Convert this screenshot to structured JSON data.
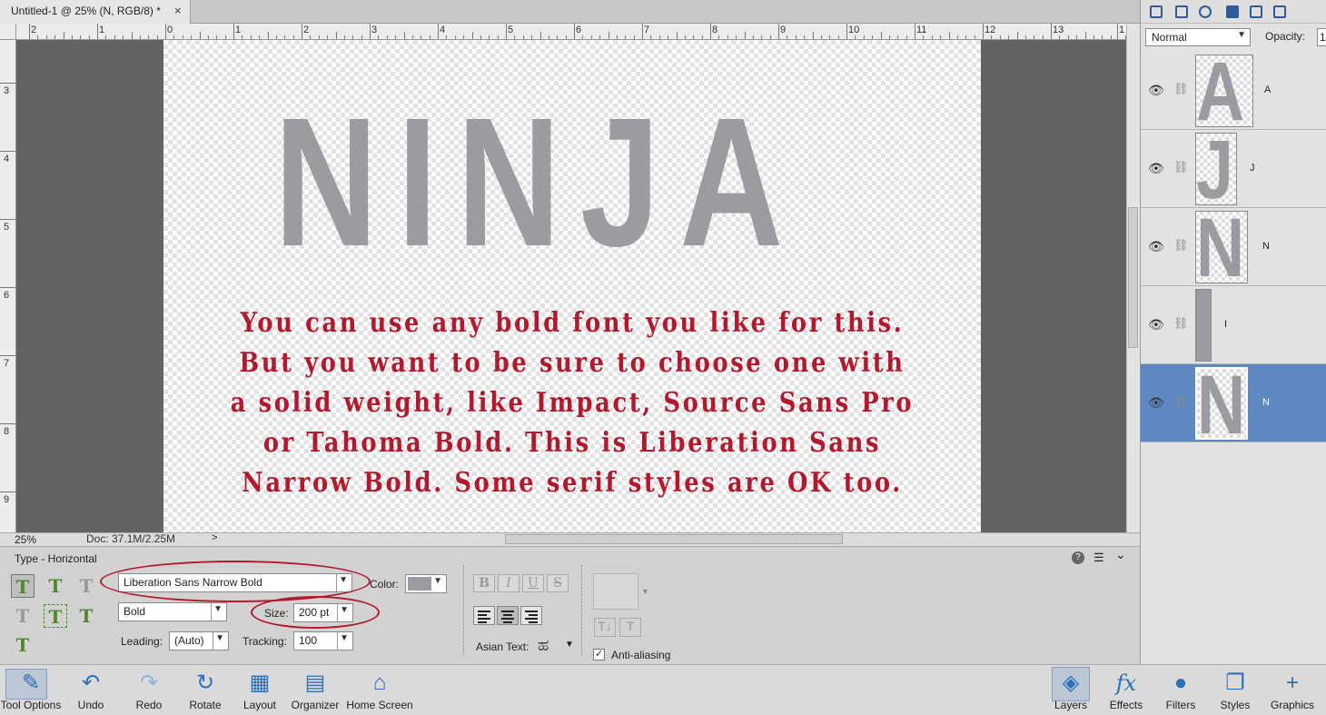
{
  "document": {
    "tab_title": "Untitled-1 @ 25% (N, RGB/8) *",
    "close_glyph": "×"
  },
  "rulers": {
    "h_labels": [
      "2",
      "1",
      "0",
      "1",
      "2",
      "3",
      "4",
      "5",
      "6",
      "7",
      "8",
      "9",
      "10",
      "11",
      "12",
      "13",
      "1"
    ],
    "v_labels": [
      "3",
      "4",
      "5",
      "6",
      "7",
      "8",
      "9"
    ]
  },
  "canvas": {
    "headline": "NINJA",
    "body_lines": [
      "You can use any bold font you like for this.",
      "But you want to be sure to choose one with",
      "a solid weight, like Impact, Source Sans Pro",
      "or Tahoma Bold. This is Liberation Sans",
      "Narrow Bold. Some serif styles are OK too."
    ],
    "text_color": "#b01a2e",
    "headline_color": "#9a9ca1"
  },
  "status": {
    "zoom": "25%",
    "doc": "Doc: 37.1M/2.25M"
  },
  "layers_panel": {
    "blend_mode": "Normal",
    "opacity_label": "Opacity:",
    "opacity_value": "1",
    "layers": [
      {
        "name": "A",
        "glyph": "A",
        "selected": false
      },
      {
        "name": "J",
        "glyph": "J",
        "selected": false
      },
      {
        "name": "N",
        "glyph": "N",
        "selected": false
      },
      {
        "name": "I",
        "glyph": "I",
        "selected": false
      },
      {
        "name": "N",
        "glyph": "N",
        "selected": true
      }
    ]
  },
  "tool_options": {
    "title": "Type - Horizontal",
    "font_family": "Liberation Sans Narrow Bold",
    "font_style": "Bold",
    "color_label": "Color:",
    "size_label": "Size:",
    "size_value": "200 pt",
    "leading_label": "Leading:",
    "leading_value": "(Auto)",
    "tracking_label": "Tracking:",
    "tracking_value": "100",
    "asian_text_label": "Asian Text:",
    "anti_aliasing_label": "Anti-aliasing",
    "anti_aliasing_checked": true,
    "format_buttons": [
      "B",
      "I",
      "U",
      "S"
    ],
    "help_glyph": "?",
    "menu_glyph": "☰",
    "collapse_glyph": "⌄"
  },
  "taskbar": {
    "left": [
      {
        "label": "Tool Options",
        "icon": "✎"
      },
      {
        "label": "Undo",
        "icon": "↶"
      },
      {
        "label": "Redo",
        "icon": "↷"
      },
      {
        "label": "Rotate",
        "icon": "↻"
      },
      {
        "label": "Layout",
        "icon": "▦"
      },
      {
        "label": "Organizer",
        "icon": "▤"
      },
      {
        "label": "Home Screen",
        "icon": "⌂"
      }
    ],
    "right": [
      {
        "label": "Layers",
        "icon": "◈"
      },
      {
        "label": "Effects",
        "icon": "fx"
      },
      {
        "label": "Filters",
        "icon": "●"
      },
      {
        "label": "Styles",
        "icon": "❐"
      },
      {
        "label": "Graphics",
        "icon": "+"
      }
    ]
  }
}
